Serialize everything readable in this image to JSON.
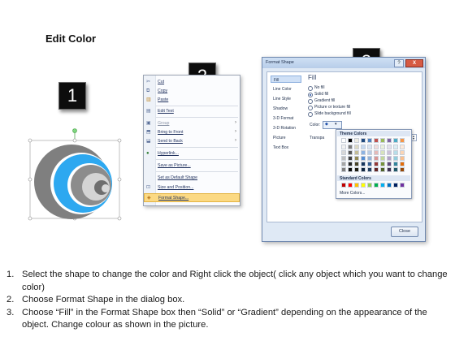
{
  "title": "Edit Color",
  "badges": [
    "1",
    "2",
    "3"
  ],
  "context_menu": {
    "items": [
      {
        "icon": "scissors-icon",
        "glyph": "✂",
        "label": "Cut",
        "submenu": false
      },
      {
        "icon": "copy-icon",
        "glyph": "⧉",
        "label": "Copy",
        "submenu": false
      },
      {
        "icon": "paste-icon",
        "glyph": "📋",
        "label": "Paste",
        "submenu": false
      },
      {
        "icon": "edit-text-icon",
        "glyph": "▤",
        "label": "Edit Text",
        "submenu": false
      },
      {
        "icon": "group-icon",
        "glyph": "▣",
        "label": "Group",
        "submenu": true
      },
      {
        "icon": "bring-to-front-icon",
        "glyph": "⬒",
        "label": "Bring to Front",
        "submenu": true
      },
      {
        "icon": "send-to-back-icon",
        "glyph": "⬓",
        "label": "Send to Back",
        "submenu": true
      },
      {
        "icon": "hyperlink-icon",
        "glyph": "🔗",
        "label": "Hyperlink...",
        "submenu": false
      },
      {
        "icon": "",
        "glyph": "",
        "label": "Save as Picture...",
        "submenu": false
      },
      {
        "icon": "",
        "glyph": "",
        "label": "Set as Default Shape",
        "submenu": false
      },
      {
        "icon": "size-position-icon",
        "glyph": "⊡",
        "label": "Size and Position...",
        "submenu": false
      },
      {
        "icon": "format-shape-icon",
        "glyph": "◈",
        "label": "Format Shape...",
        "submenu": false,
        "highlighted": true
      }
    ]
  },
  "dialog": {
    "title": "Format Shape",
    "help": "?",
    "close_x": "X",
    "categories": [
      "Fill",
      "Line Color",
      "Line Style",
      "Shadow",
      "3-D Format",
      "3-D Rotation",
      "Picture",
      "Text Box"
    ],
    "active_category": "Fill",
    "fill_heading": "Fill",
    "fill_options": [
      {
        "label": "No fill",
        "selected": false
      },
      {
        "label": "Solid fill",
        "selected": true
      },
      {
        "label": "Gradient fill",
        "selected": false
      },
      {
        "label": "Picture or texture fill",
        "selected": false
      },
      {
        "label": "Slide background fill",
        "selected": false
      }
    ],
    "color_label": "Color:",
    "transparency_label": "Transpa",
    "theme_colors_label": "Theme Colors",
    "standard_colors_label": "Standard Colors",
    "more_colors_label": "More Colors...",
    "close_button": "Close",
    "theme_colors": [
      [
        "#ffffff",
        "#000000",
        "#eeece1",
        "#1f497d",
        "#4f81bd",
        "#c0504d",
        "#9bbb59",
        "#8064a2",
        "#4bacc6",
        "#f79646"
      ],
      [
        "#f2f2f2",
        "#7f7f7f",
        "#ddd9c3",
        "#c6d9f0",
        "#dbe5f1",
        "#f2dcdb",
        "#ebf1dd",
        "#e5e0ec",
        "#dbeef3",
        "#fdeada"
      ],
      [
        "#d8d8d8",
        "#595959",
        "#c4bd97",
        "#8db3e2",
        "#b8cce4",
        "#e5b9b7",
        "#d7e3bc",
        "#ccc1d9",
        "#b7dde8",
        "#fbd5b5"
      ],
      [
        "#bfbfbf",
        "#3f3f3f",
        "#938953",
        "#548dd4",
        "#95b3d7",
        "#d99694",
        "#c3d69b",
        "#b2a2c7",
        "#92cddc",
        "#fac08f"
      ],
      [
        "#a5a5a5",
        "#262626",
        "#494429",
        "#17365d",
        "#366092",
        "#953734",
        "#76923c",
        "#5f497a",
        "#31859b",
        "#e36c09"
      ],
      [
        "#7f7f7f",
        "#0c0c0c",
        "#1d1b10",
        "#0f243e",
        "#244061",
        "#632423",
        "#4f6128",
        "#3f3151",
        "#205867",
        "#974806"
      ]
    ],
    "standard_colors": [
      "#c00000",
      "#ff0000",
      "#ffc000",
      "#ffff00",
      "#92d050",
      "#00b050",
      "#00b0f0",
      "#0070c0",
      "#002060",
      "#7030a0"
    ]
  },
  "shape_colors": {
    "outer": "#7f7f7f",
    "blue": "#2da8f0",
    "light": "#d4d4d4"
  },
  "instructions": [
    {
      "num": "1.",
      "text": "Select the shape to change the color and Right click the object( click any object which you want to change color)"
    },
    {
      "num": "2.",
      "text": "Choose Format Shape in the dialog box."
    },
    {
      "num": "3.",
      "text": "Choose “Fill” in the Format Shape box then “Solid” or “Gradient” depending on the appearance of the object. Change colour as shown in the picture."
    }
  ]
}
